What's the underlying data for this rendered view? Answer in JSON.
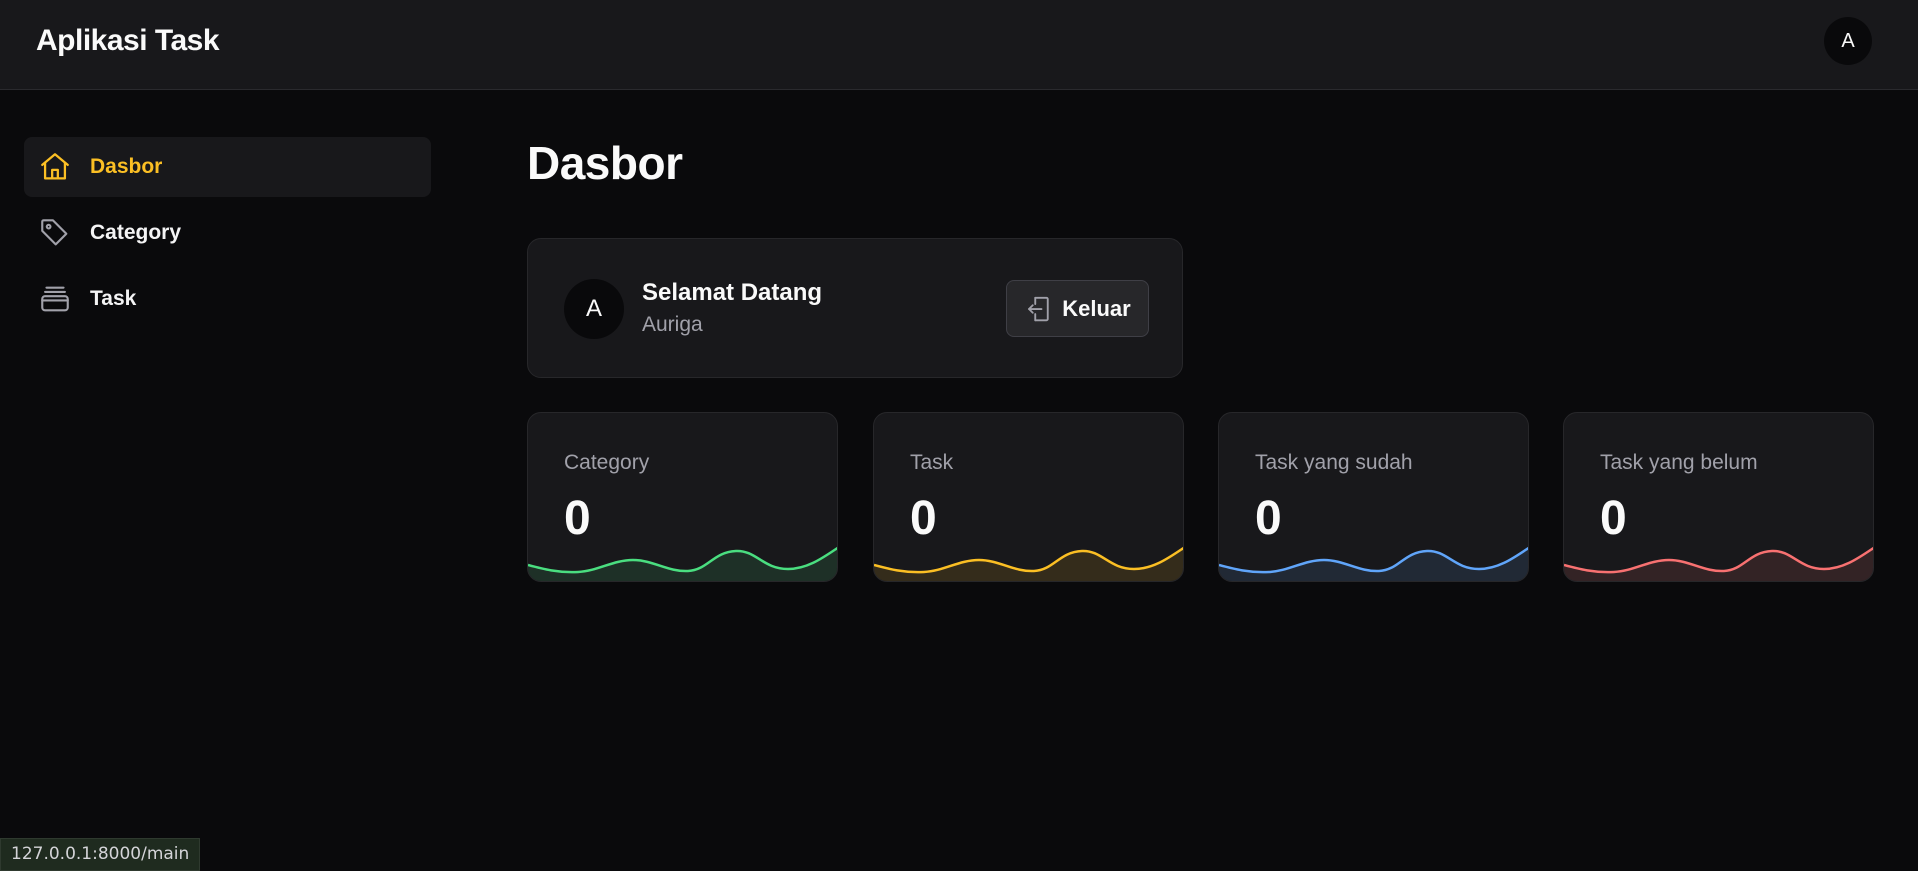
{
  "app": {
    "title": "Aplikasi Task",
    "avatar_initial": "A"
  },
  "sidebar": {
    "items": [
      {
        "label": "Dasbor",
        "icon": "home-icon",
        "active": true
      },
      {
        "label": "Category",
        "icon": "tag-icon",
        "active": false
      },
      {
        "label": "Task",
        "icon": "archive-icon",
        "active": false
      }
    ]
  },
  "main": {
    "title": "Dasbor",
    "welcome": {
      "avatar_initial": "A",
      "title": "Selamat Datang",
      "name": "Auriga",
      "logout_label": "Keluar"
    },
    "stats": [
      {
        "label": "Category",
        "value": "0",
        "color": "#4ade80"
      },
      {
        "label": "Task",
        "value": "0",
        "color": "#fbbf24"
      },
      {
        "label": "Task yang sudah",
        "value": "0",
        "color": "#60a5fa"
      },
      {
        "label": "Task yang belum",
        "value": "0",
        "color": "#f87171"
      }
    ]
  },
  "statusbar": {
    "url": "127.0.0.1:8000/main"
  },
  "colors": {
    "accent": "#fbbf24",
    "background": "#0a0a0c",
    "surface": "#18181b"
  }
}
